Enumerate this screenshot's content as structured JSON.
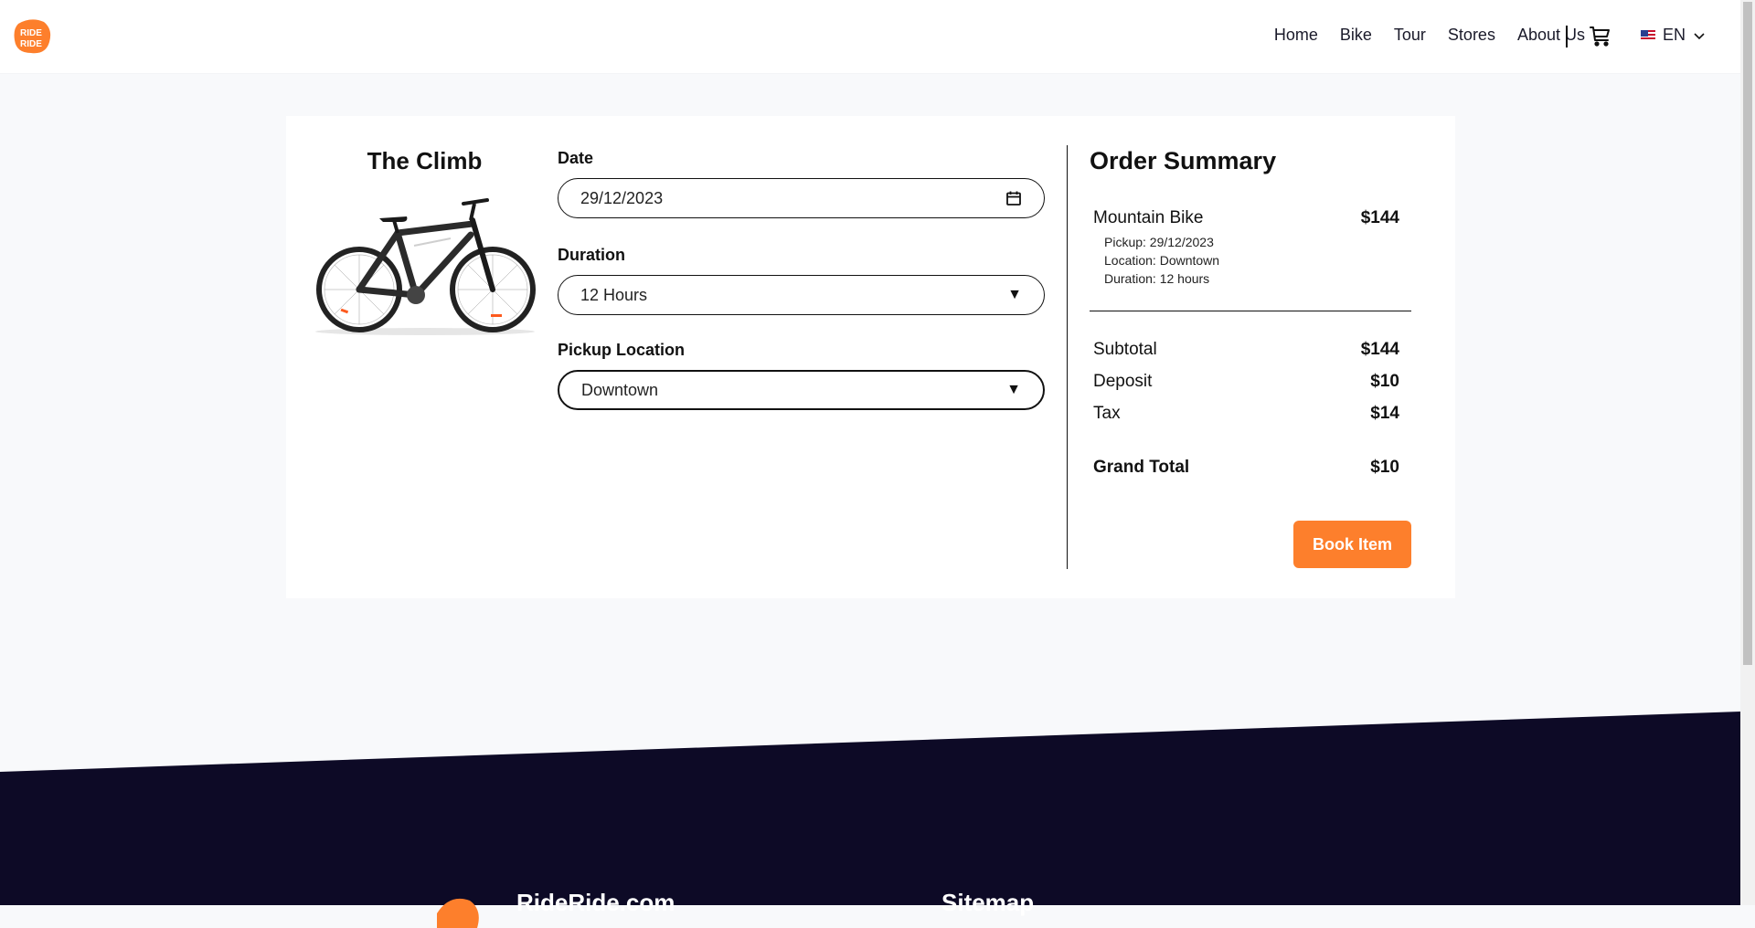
{
  "header": {
    "logo_text_top": "RIDE",
    "logo_text_bottom": "RIDE",
    "nav": [
      "Home",
      "Bike",
      "Tour",
      "Stores",
      "About Us"
    ],
    "cart_icon": "cart-icon",
    "language": "EN",
    "flag_icon": "us-flag-icon"
  },
  "product": {
    "title": "The Climb",
    "image": "mountain-bike-image"
  },
  "form": {
    "date_label": "Date",
    "date_value": "29/12/2023",
    "duration_label": "Duration",
    "duration_value": "12 Hours",
    "location_label": "Pickup Location",
    "location_value": "Downtown",
    "caret": "▼"
  },
  "summary": {
    "title": "Order Summary",
    "item_name": "Mountain Bike",
    "item_price": "$144",
    "pickup": "Pickup: 29/12/2023",
    "location": "Location: Downtown",
    "duration": "Duration: 12 hours",
    "subtotal_label": "Subtotal",
    "subtotal_value": "$144",
    "deposit_label": "Deposit",
    "deposit_value": "$10",
    "tax_label": "Tax",
    "tax_value": "$14",
    "grand_total_label": "Grand Total",
    "grand_total_value": "$10",
    "book_label": "Book Item"
  },
  "footer": {
    "brand": "RideRide.com",
    "sitemap": "Sitemap"
  },
  "colors": {
    "accent": "#fd7f2c",
    "footer_bg": "#0d0a26",
    "page_bg": "#f8f9fb"
  }
}
